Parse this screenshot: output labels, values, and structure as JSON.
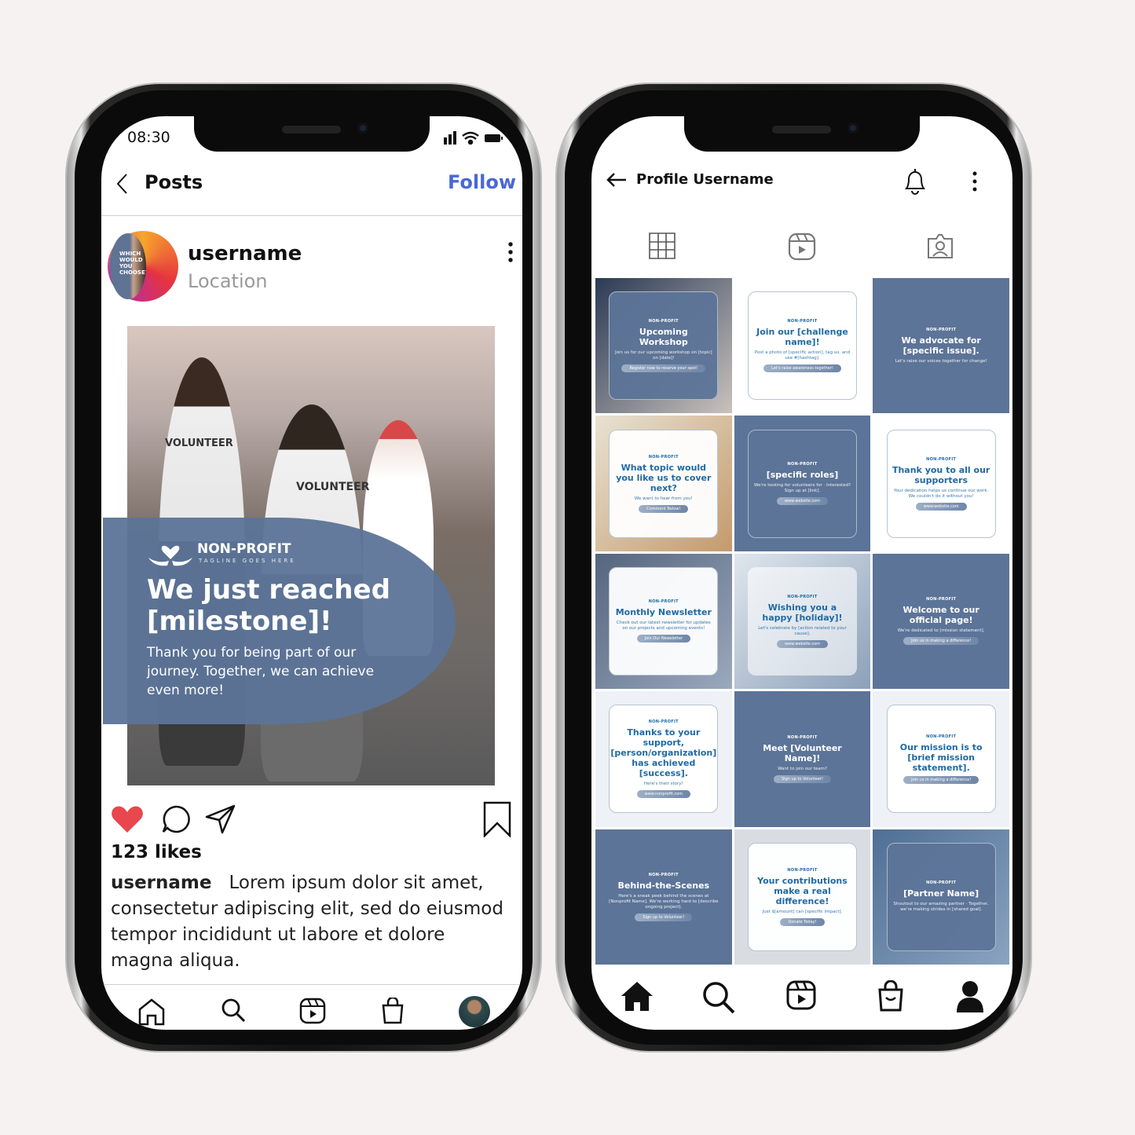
{
  "colors": {
    "background": "#f6f2f1",
    "brand_blue": "#5c7498",
    "follow_blue": "#4a67d6",
    "heart_red": "#e8474d",
    "tile_text_blue": "#1f6aa5"
  },
  "left_phone": {
    "status": {
      "time": "08:30",
      "icons": [
        "signal-icon",
        "wifi-icon",
        "battery-icon"
      ]
    },
    "header": {
      "back_icon": "chevron-left-icon",
      "title": "Posts",
      "follow": "Follow"
    },
    "post": {
      "username": "username",
      "location": "Location",
      "avatar_text": "WHICH WOULD YOU CHOOSE?",
      "overlay": {
        "brand": "NON-PROFIT",
        "tagline": "TAGLINE GOES HERE",
        "title": "We just reached [milestone]!",
        "body": "Thank you for being part of our journey. Together, we can achieve even more!"
      },
      "photo_text": [
        "VOLUNTEER",
        "VOLUNTEER"
      ],
      "liked": true,
      "likes": "123 likes",
      "caption_user": "username",
      "caption": "Lorem ipsum dolor sit amet, consectetur adipiscing elit, sed do eiusmod tempor incididunt ut labore et dolore magna aliqua."
    },
    "nav": [
      "home-icon",
      "search-icon",
      "reels-icon",
      "shop-icon",
      "profile-avatar"
    ]
  },
  "right_phone": {
    "header": {
      "back_icon": "arrow-left-icon",
      "title": "Profile Username"
    },
    "tabs": [
      "grid-icon",
      "reels-icon",
      "tagged-icon"
    ],
    "brand": "NON-PROFIT",
    "tiles": [
      {
        "style": "blue-card",
        "title": "Upcoming Workshop",
        "subtitle": "Join us for our upcoming workshop on [topic] on [date]!",
        "button": "Register now to reserve your spot!"
      },
      {
        "style": "white-card",
        "title": "Join our [challenge name]!",
        "subtitle": "Post a photo of [specific action], tag us, and use #[hashtag].",
        "button": "Let's raise awareness together!"
      },
      {
        "style": "blue",
        "title": "We advocate for [specific issue].",
        "subtitle": "Let's raise our voices together for change!",
        "button": ""
      },
      {
        "style": "white-card",
        "title": "What topic would you like us to cover next?",
        "subtitle": "We want to hear from you!",
        "button": "Comment Below!"
      },
      {
        "style": "blue-card",
        "title": "[specific roles]",
        "subtitle": "We're looking for volunteers for · Interested? Sign up at [link].",
        "button": "www.website.com"
      },
      {
        "style": "white-card",
        "title": "Thank you to all our supporters",
        "subtitle": "Your dedication helps us continue our work. We couldn't do it without you!",
        "button": "www.website.com"
      },
      {
        "style": "white-card",
        "title": "Monthly Newsletter",
        "subtitle": "Check out our latest newsletter for updates on our projects and upcoming events!",
        "button": "Join Our Newsletter"
      },
      {
        "style": "light",
        "title": "Wishing you a happy [holiday]!",
        "subtitle": "Let's celebrate by [action related to your cause].",
        "button": "www.website.com"
      },
      {
        "style": "blue",
        "title": "Welcome to our official page!",
        "subtitle": "We're dedicated to [mission statement].",
        "button": "Join us in making a difference!"
      },
      {
        "style": "white-card",
        "title": "Thanks to your support, [person/organization] has achieved [success].",
        "subtitle": "Here's their story!",
        "button": "www.nonprofit.com"
      },
      {
        "style": "blue",
        "title": "Meet [Volunteer Name]!",
        "subtitle": "Want to join our team?",
        "button": "Sign up to Volunteer!"
      },
      {
        "style": "white-card",
        "title": "Our mission is to [brief mission statement].",
        "subtitle": "",
        "button": "Join us in making a difference!"
      },
      {
        "style": "blue",
        "title": "Behind-the-Scenes",
        "subtitle": "Here's a sneak peek behind the scenes at [Nonprofit Name]. We're working hard to [describe ongoing project].",
        "button": "Sign up to Volunteer!"
      },
      {
        "style": "white-card",
        "title": "Your contributions make a real difference!",
        "subtitle": "Just $[amount] can [specific impact].",
        "button": "Donate Today!"
      },
      {
        "style": "blue-card",
        "title": "[Partner Name]",
        "subtitle": "Shoutout to our amazing partner · Together, we're making strides in [shared goal].",
        "button": ""
      }
    ],
    "nav": [
      "home-icon",
      "search-icon",
      "reels-icon",
      "shop-icon",
      "profile-icon"
    ]
  }
}
